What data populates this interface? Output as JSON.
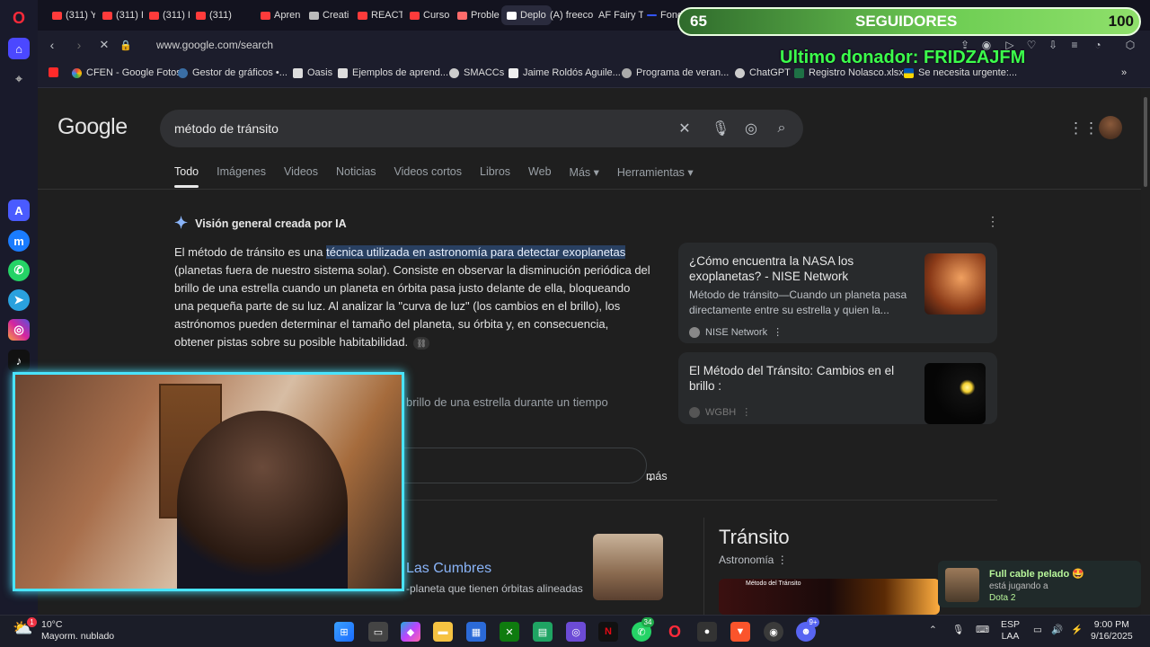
{
  "browser": {
    "tabs": [
      {
        "label": "(311) Y",
        "color": "#ff3b3b"
      },
      {
        "label": "(311) I",
        "color": "#ff3b3b"
      },
      {
        "label": "(311) I",
        "color": "#ff3b3b"
      },
      {
        "label": "(311)",
        "color": "#ff3b3b"
      },
      {
        "label": "Apren",
        "color": "#ff3b3b"
      },
      {
        "label": "Creati",
        "color": "#bbbbbb"
      },
      {
        "label": "REACT",
        "color": "#ff3b3b"
      },
      {
        "label": "Curso",
        "color": "#ff3b3b"
      },
      {
        "label": "Proble",
        "color": "#ff6b6b"
      },
      {
        "label": "Deplo",
        "color": "#ffffff"
      },
      {
        "label": "(A) freeco",
        "color": "#dddddd"
      },
      {
        "label": "AF Fairy T",
        "color": "#ffcc33"
      },
      {
        "label": "Fond",
        "color": "#3355ff"
      }
    ],
    "url": "www.google.com/search",
    "bookmarks": [
      {
        "label": "",
        "icon": "youtube-icon"
      },
      {
        "label": "CFEN - Google Fotos",
        "icon": "photos-icon"
      },
      {
        "label": "Gestor de gráficos •...",
        "icon": "chart-icon"
      },
      {
        "label": "Oasis",
        "icon": "doc-icon"
      },
      {
        "label": "Ejemplos de aprend...",
        "icon": "doc-icon"
      },
      {
        "label": "SMACCs",
        "icon": "wordpress-icon"
      },
      {
        "label": "Jaime Roldós Aguile...",
        "icon": "wikipedia-icon"
      },
      {
        "label": "Programa de veran...",
        "icon": "gear-icon"
      },
      {
        "label": "ChatGPT",
        "icon": "chatgpt-icon"
      },
      {
        "label": "Registro Nolasco.xlsx",
        "icon": "excel-icon"
      },
      {
        "label": "Se necesita urgente:...",
        "icon": "flag-icon"
      }
    ]
  },
  "google": {
    "logo": "Google",
    "query": "método de tránsito",
    "tabs": [
      "Todo",
      "Imágenes",
      "Videos",
      "Noticias",
      "Videos cortos",
      "Libros",
      "Web",
      "Más ▾",
      "Herramientas ▾"
    ],
    "ai_overview": {
      "header": "Visión general creada por IA",
      "text_before": "El método de tránsito es una ",
      "highlight": "técnica utilizada en astronomía para detectar exoplanetas",
      "text_after": " (planetas fuera de nuestro sistema solar). Consiste en observar la disminución periódica del brillo de una estrella cuando un planeta en órbita pasa justo delante de ella, bloqueando una pequeña parte de su luz. Al analizar la \"curva de luz\" (los cambios en el brillo), los astrónomos pueden determinar el tamaño del planeta, su órbita y, en consecuencia, obtener pistas sobre su posible habitabilidad.",
      "continuation": "brillo de una estrella durante un tiempo",
      "more_label": "más"
    },
    "cards": [
      {
        "title": "¿Cómo encuentra la NASA los exoplanetas? - NISE Network",
        "snippet": "Método de tránsito—Cuando un planeta pasa directamente entre su estrella y quien la...",
        "source": "NISE Network"
      },
      {
        "title": "El Método del Tránsito: Cambios en el brillo :",
        "snippet": "",
        "source": "WGBH"
      }
    ],
    "result": {
      "title": "Las Cumbres",
      "snippet": "-planeta que tienen órbitas alineadas"
    },
    "knowledge_panel": {
      "title": "Tránsito",
      "subtitle": "Astronomía",
      "image_caption": "Método del Tránsito"
    }
  },
  "overlay": {
    "followers_count": "65",
    "followers_label": "SEGUIDORES",
    "followers_goal": "100",
    "followers_progress": 0.65,
    "donor": "Ultimo donador: FRIDZAJFM",
    "notification": {
      "name": "Full cable pelado 🤩",
      "action": "está jugando a",
      "game": "Dota 2"
    }
  },
  "taskbar": {
    "weather_temp": "10°C",
    "weather_desc": "Mayorm. nublado",
    "weather_badge": "1",
    "lang_top": "ESP",
    "lang_bottom": "LAA",
    "time": "9:00 PM",
    "date": "9/16/2025",
    "whatsapp_badge": "34",
    "discord_badge": "9+"
  }
}
